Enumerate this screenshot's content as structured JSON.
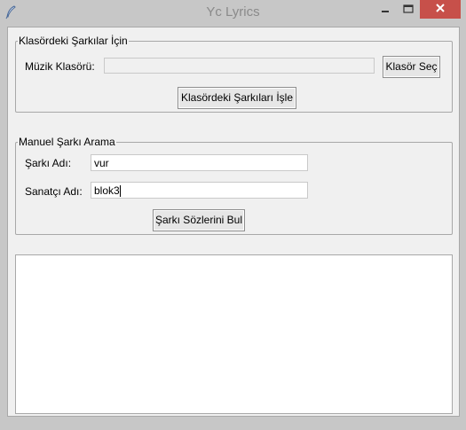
{
  "window": {
    "title": "Yc Lyrics",
    "accent_close": "#c7504a"
  },
  "folder_group": {
    "legend": "Klasördeki Şarkılar İçin",
    "folder_label": "Müzik Klasörü:",
    "folder_value": "",
    "browse_button": "Klasör Seç",
    "process_button": "Klasördeki Şarkıları İşle"
  },
  "manual_group": {
    "legend": "Manuel Şarkı Arama",
    "song_label": "Şarkı Adı:",
    "song_value": "vur",
    "artist_label": "Sanatçı Adı:",
    "artist_value": "blok3",
    "find_button": "Şarkı Sözlerini Bul"
  },
  "lyrics_output": {
    "text": ""
  },
  "icons": {
    "app": "feather-icon",
    "minimize": "minimize-icon",
    "maximize": "maximize-icon",
    "close": "close-icon"
  }
}
